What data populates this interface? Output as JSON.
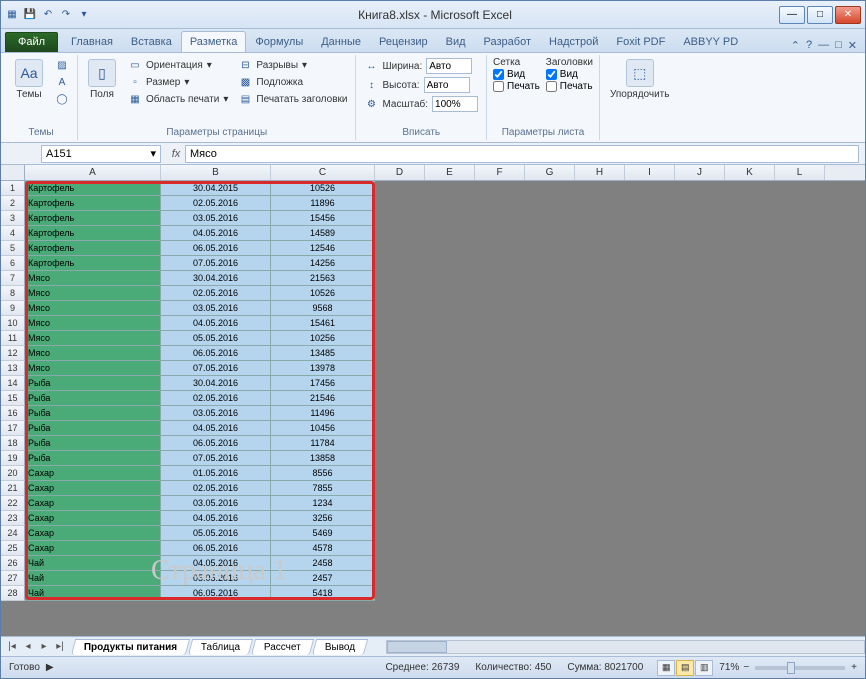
{
  "title_bar": {
    "doc_title": "Книга8.xlsx  -  Microsoft Excel"
  },
  "ribbon_tabs": {
    "file": "Файл",
    "items": [
      "Главная",
      "Вставка",
      "Разметка",
      "Формулы",
      "Данные",
      "Рецензир",
      "Вид",
      "Разработ",
      "Надстрой",
      "Foxit PDF",
      "ABBYY PD"
    ],
    "active": "Разметка"
  },
  "ribbon": {
    "themes": {
      "themes_btn": "Темы",
      "title": "Темы"
    },
    "page_setup": {
      "fields": "Поля",
      "orientation": "Ориентация",
      "size": "Размер",
      "print_area": "Область печати",
      "breaks": "Разрывы",
      "background": "Подложка",
      "print_titles": "Печатать заголовки",
      "title": "Параметры страницы"
    },
    "fit": {
      "width_lbl": "Ширина:",
      "width_val": "Авто",
      "height_lbl": "Высота:",
      "height_val": "Авто",
      "scale_lbl": "Масштаб:",
      "scale_val": "100%",
      "title": "Вписать"
    },
    "sheet_opts": {
      "grid_title": "Сетка",
      "headings_title": "Заголовки",
      "view": "Вид",
      "print": "Печать",
      "title": "Параметры листа"
    },
    "arrange": {
      "btn": "Упорядочить",
      "title": ""
    }
  },
  "name_box": "A151",
  "formula_value": "Мясо",
  "columns": [
    "A",
    "B",
    "C",
    "D",
    "E",
    "F",
    "G",
    "H",
    "I",
    "J",
    "K",
    "L"
  ],
  "rows": [
    {
      "n": 1,
      "a": "Картофель",
      "b": "30.04.2015",
      "c": "10526"
    },
    {
      "n": 2,
      "a": "Картофель",
      "b": "02.05.2016",
      "c": "11896"
    },
    {
      "n": 3,
      "a": "Картофель",
      "b": "03.05.2016",
      "c": "15456"
    },
    {
      "n": 4,
      "a": "Картофель",
      "b": "04.05.2016",
      "c": "14589"
    },
    {
      "n": 5,
      "a": "Картофель",
      "b": "06.05.2016",
      "c": "12546"
    },
    {
      "n": 6,
      "a": "Картофель",
      "b": "07.05.2016",
      "c": "14256"
    },
    {
      "n": 7,
      "a": "Мясо",
      "b": "30.04.2016",
      "c": "21563"
    },
    {
      "n": 8,
      "a": "Мясо",
      "b": "02.05.2016",
      "c": "10526"
    },
    {
      "n": 9,
      "a": "Мясо",
      "b": "03.05.2016",
      "c": "9568"
    },
    {
      "n": 10,
      "a": "Мясо",
      "b": "04.05.2016",
      "c": "15461"
    },
    {
      "n": 11,
      "a": "Мясо",
      "b": "05.05.2016",
      "c": "10256"
    },
    {
      "n": 12,
      "a": "Мясо",
      "b": "06.05.2016",
      "c": "13485"
    },
    {
      "n": 13,
      "a": "Мясо",
      "b": "07.05.2016",
      "c": "13978"
    },
    {
      "n": 14,
      "a": "Рыба",
      "b": "30.04.2016",
      "c": "17456"
    },
    {
      "n": 15,
      "a": "Рыба",
      "b": "02.05.2016",
      "c": "21546"
    },
    {
      "n": 16,
      "a": "Рыба",
      "b": "03.05.2016",
      "c": "11496"
    },
    {
      "n": 17,
      "a": "Рыба",
      "b": "04.05.2016",
      "c": "10456"
    },
    {
      "n": 18,
      "a": "Рыба",
      "b": "06.05.2016",
      "c": "11784"
    },
    {
      "n": 19,
      "a": "Рыба",
      "b": "07.05.2016",
      "c": "13858"
    },
    {
      "n": 20,
      "a": "Сахар",
      "b": "01.05.2016",
      "c": "8556"
    },
    {
      "n": 21,
      "a": "Сахар",
      "b": "02.05.2016",
      "c": "7855"
    },
    {
      "n": 22,
      "a": "Сахар",
      "b": "03.05.2016",
      "c": "1234"
    },
    {
      "n": 23,
      "a": "Сахар",
      "b": "04.05.2016",
      "c": "3256"
    },
    {
      "n": 24,
      "a": "Сахар",
      "b": "05.05.2016",
      "c": "5469"
    },
    {
      "n": 25,
      "a": "Сахар",
      "b": "06.05.2016",
      "c": "4578"
    },
    {
      "n": 26,
      "a": "Чай",
      "b": "04.05.2016",
      "c": "2458"
    },
    {
      "n": 27,
      "a": "Чай",
      "b": "05.05.2016",
      "c": "2457"
    },
    {
      "n": 28,
      "a": "Чай",
      "b": "06.05.2016",
      "c": "5418"
    }
  ],
  "watermark": "Страница 1",
  "sheet_tabs": [
    "Продукты питания",
    "Таблица",
    "Рассчет",
    "Вывод"
  ],
  "active_sheet": "Продукты питания",
  "status": {
    "ready": "Готово",
    "avg_lbl": "Среднее:",
    "avg": "26739",
    "count_lbl": "Количество:",
    "count": "450",
    "sum_lbl": "Сумма:",
    "sum": "8021700",
    "zoom": "71%"
  }
}
